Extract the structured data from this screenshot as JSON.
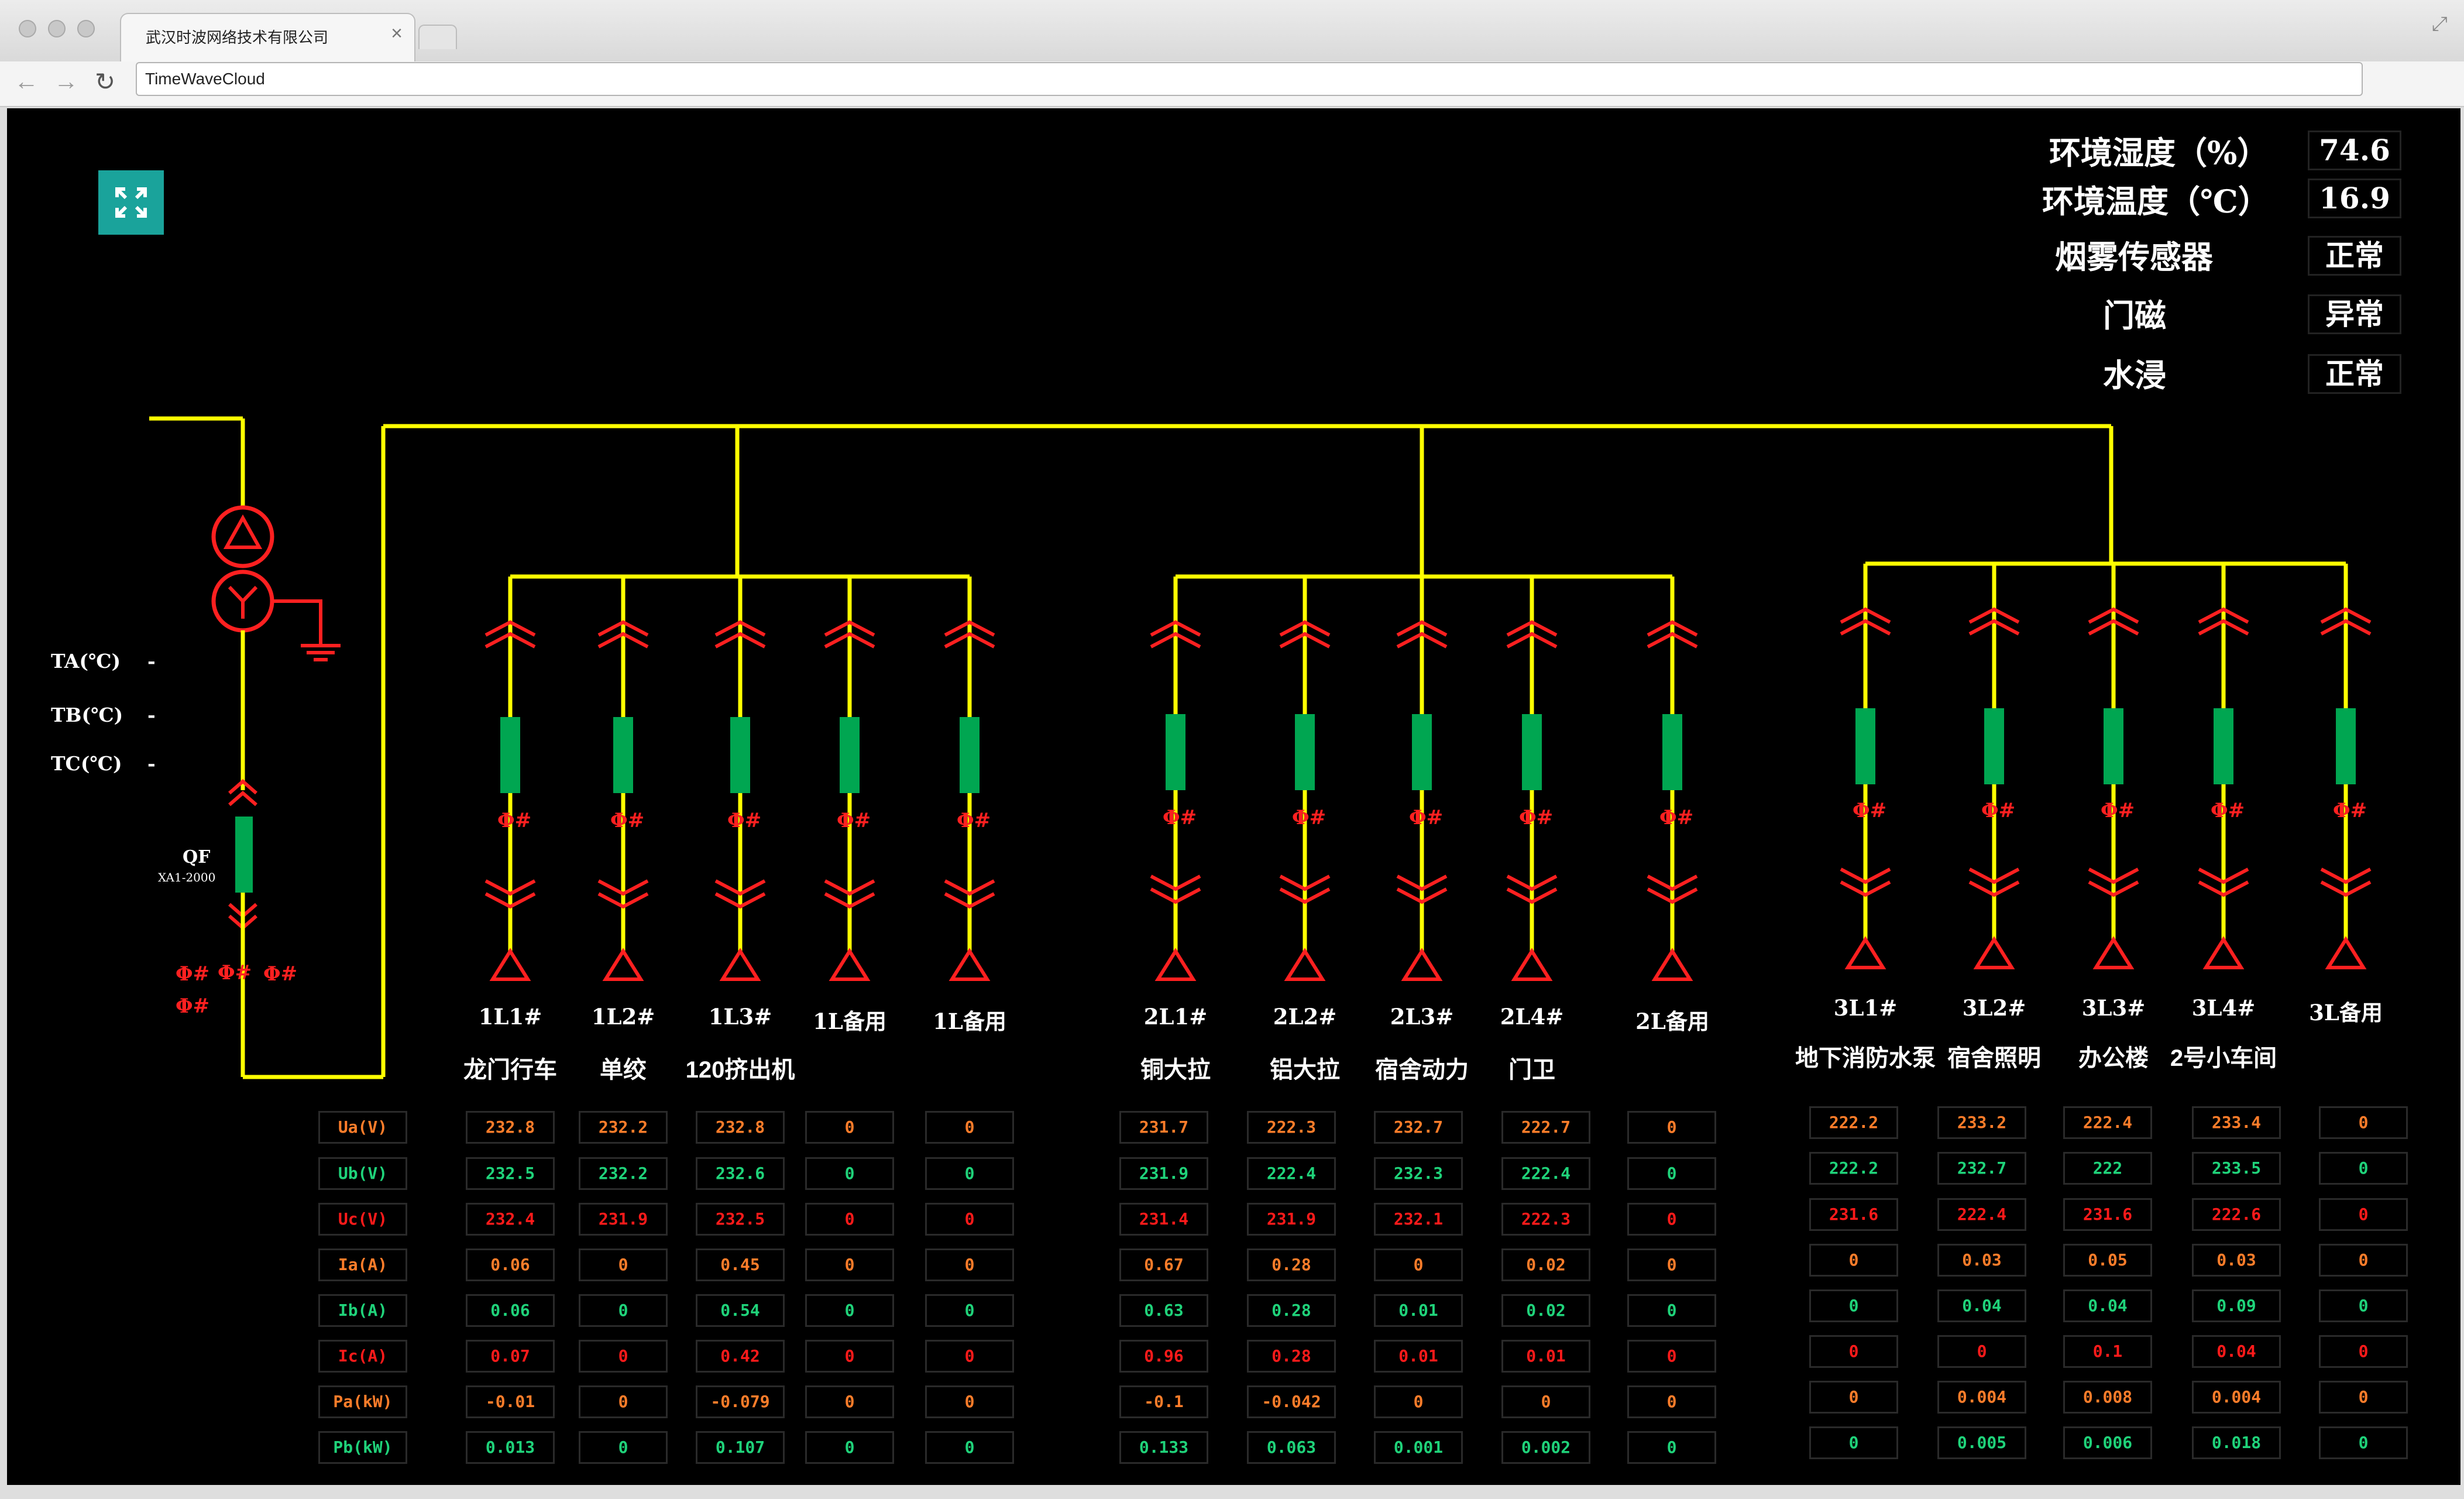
{
  "browser": {
    "tab_title": "武汉时波网络技术有限公司",
    "tab_close": "×",
    "address": "TimeWaveCloud",
    "back_glyph": "←",
    "forward_glyph": "→",
    "reload_glyph": "↻",
    "expand_glyph": "⤢"
  },
  "env": [
    {
      "label": "环境湿度（%）",
      "value": "74.6"
    },
    {
      "label": "环境温度（℃）",
      "value": "16.9"
    },
    {
      "label": "烟雾传感器",
      "value": "正常"
    },
    {
      "label": "门磁",
      "value": "异常"
    },
    {
      "label": "水浸",
      "value": "正常"
    }
  ],
  "temps": [
    {
      "label": "TA(℃)",
      "value": "-"
    },
    {
      "label": "TB(℃)",
      "value": "-"
    },
    {
      "label": "TC(℃)",
      "value": "-"
    }
  ],
  "breaker": {
    "label": "QF",
    "model": "XA1-2000"
  },
  "meter_symbol": "Φ#",
  "icons": {
    "fullscreen": "fullscreen-icon"
  },
  "colors": {
    "busbar": "#ffff00",
    "breaker": "#00a651",
    "symbol": "#ff2020",
    "phase_a": "#ff7d2a",
    "phase_b": "#1fd37a",
    "phase_c": "#ff1a1a",
    "fullscreen_bg": "#1aa39b"
  },
  "row_labels": [
    "Ua(V)",
    "Ub(V)",
    "Uc(V)",
    "Ia(A)",
    "Ib(A)",
    "Ic(A)",
    "Pa(kW)",
    "Pb(kW)"
  ],
  "groups": [
    {
      "feeders": [
        {
          "code": "1L1#",
          "name": "龙门行车",
          "values": [
            "232.8",
            "232.5",
            "232.4",
            "0.06",
            "0.06",
            "0.07",
            "-0.01",
            "0.013"
          ]
        },
        {
          "code": "1L2#",
          "name": "单绞",
          "values": [
            "232.2",
            "232.2",
            "231.9",
            "0",
            "0",
            "0",
            "0",
            "0"
          ]
        },
        {
          "code": "1L3#",
          "name": "120挤出机",
          "values": [
            "232.8",
            "232.6",
            "232.5",
            "0.45",
            "0.54",
            "0.42",
            "-0.079",
            "0.107"
          ]
        },
        {
          "code": "1L备用",
          "name": "",
          "values": [
            "0",
            "0",
            "0",
            "0",
            "0",
            "0",
            "0",
            "0"
          ]
        },
        {
          "code": "1L备用",
          "name": "",
          "values": [
            "0",
            "0",
            "0",
            "0",
            "0",
            "0",
            "0",
            "0"
          ]
        }
      ]
    },
    {
      "feeders": [
        {
          "code": "2L1#",
          "name": "铜大拉",
          "values": [
            "231.7",
            "231.9",
            "231.4",
            "0.67",
            "0.63",
            "0.96",
            "-0.1",
            "0.133"
          ]
        },
        {
          "code": "2L2#",
          "name": "铝大拉",
          "values": [
            "222.3",
            "222.4",
            "231.9",
            "0.28",
            "0.28",
            "0.28",
            "-0.042",
            "0.063"
          ]
        },
        {
          "code": "2L3#",
          "name": "宿舍动力",
          "values": [
            "232.7",
            "232.3",
            "232.1",
            "0",
            "0.01",
            "0.01",
            "0",
            "0.001"
          ]
        },
        {
          "code": "2L4#",
          "name": "门卫",
          "values": [
            "222.7",
            "222.4",
            "222.3",
            "0.02",
            "0.02",
            "0.01",
            "0",
            "0.002"
          ]
        },
        {
          "code": "2L备用",
          "name": "",
          "values": [
            "0",
            "0",
            "0",
            "0",
            "0",
            "0",
            "0",
            "0"
          ]
        }
      ]
    },
    {
      "feeders": [
        {
          "code": "3L1#",
          "name": "地下消防水泵",
          "values": [
            "222.2",
            "222.2",
            "231.6",
            "0",
            "0",
            "0",
            "0",
            "0"
          ]
        },
        {
          "code": "3L2#",
          "name": "宿舍照明",
          "values": [
            "233.2",
            "232.7",
            "222.4",
            "0.03",
            "0.04",
            "0",
            "0.004",
            "0.005"
          ]
        },
        {
          "code": "3L3#",
          "name": "办公楼",
          "values": [
            "222.4",
            "222",
            "231.6",
            "0.05",
            "0.04",
            "0.1",
            "0.008",
            "0.006"
          ]
        },
        {
          "code": "3L4#",
          "name": "2号小车间",
          "values": [
            "233.4",
            "233.5",
            "222.6",
            "0.03",
            "0.09",
            "0.04",
            "0.004",
            "0.018"
          ]
        },
        {
          "code": "3L备用",
          "name": "",
          "values": [
            "0",
            "0",
            "0",
            "0",
            "0",
            "0",
            "0",
            "0"
          ]
        }
      ]
    }
  ]
}
